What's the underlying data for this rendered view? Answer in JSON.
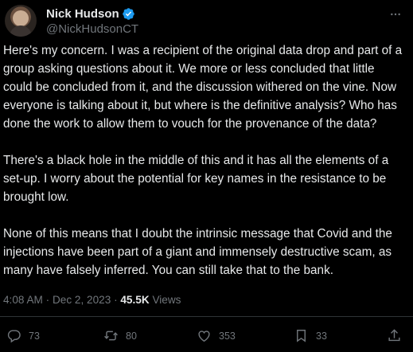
{
  "author": {
    "display_name": "Nick Hudson",
    "handle": "@NickHudsonCT",
    "verified": true,
    "verified_color": "#1d9bf0"
  },
  "post": {
    "paragraphs": [
      "Here's my concern. I was a recipient of the original data drop and part of a group asking questions about it. We more or less concluded that little could be concluded from it, and the discussion withered on the vine. Now everyone is talking about it, but where is the definitive analysis? Who has done the work to allow them to vouch for the provenance of the data?",
      "There's a black hole in the middle of this and it has all the elements of a set-up. I worry about the potential for key names in the resistance to be brought low.",
      "None of this means that I doubt the intrinsic message that Covid and the injections have been part of a giant and immensely destructive scam, as many have falsely inferred. You can still take that to the bank."
    ],
    "time": "4:08 AM",
    "separator": "·",
    "date": "Dec 2, 2023",
    "views_count": "45.5K",
    "views_label": "Views"
  },
  "actions": {
    "replies": "73",
    "reposts": "80",
    "likes": "353",
    "bookmarks": "33"
  },
  "icons": {
    "more": "more-dots-icon",
    "reply": "reply-bubble-icon",
    "repost": "repost-arrows-icon",
    "like": "heart-icon",
    "bookmark": "bookmark-icon",
    "share": "share-upload-icon"
  },
  "colors": {
    "background": "#000000",
    "text": "#e7e9ea",
    "muted": "#71767b",
    "divider": "#2f3336"
  }
}
